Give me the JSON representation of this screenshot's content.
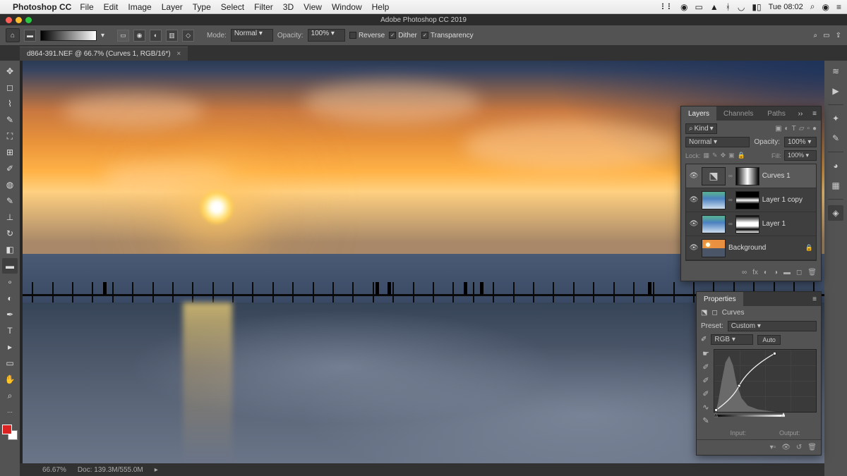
{
  "menubar": {
    "app": "Photoshop CC",
    "items": [
      "File",
      "Edit",
      "Image",
      "Layer",
      "Type",
      "Select",
      "Filter",
      "3D",
      "View",
      "Window",
      "Help"
    ],
    "clock": "Tue 08:02"
  },
  "app_titlebar": {
    "title": "Adobe Photoshop CC 2019"
  },
  "options": {
    "mode_label": "Mode:",
    "mode_value": "Normal",
    "opacity_label": "Opacity:",
    "opacity_value": "100%",
    "reverse": "Reverse",
    "dither": "Dither",
    "transparency": "Transparency"
  },
  "doc_tab": {
    "title": "d864-391.NEF @ 66.7% (Curves 1, RGB/16*)"
  },
  "status": {
    "zoom": "66.67%",
    "doc": "Doc: 139.3M/555.0M"
  },
  "layers_panel": {
    "tabs": [
      "Layers",
      "Channels",
      "Paths"
    ],
    "filter_label": "Kind",
    "blend_mode": "Normal",
    "opacity_label": "Opacity:",
    "opacity_value": "100%",
    "lock_label": "Lock:",
    "fill_label": "Fill:",
    "fill_value": "100%",
    "layers": [
      {
        "name": "Curves 1"
      },
      {
        "name": "Layer 1 copy"
      },
      {
        "name": "Layer 1"
      },
      {
        "name": "Background"
      }
    ]
  },
  "properties_panel": {
    "tab": "Properties",
    "adj_name": "Curves",
    "preset_label": "Preset:",
    "preset_value": "Custom",
    "channel_value": "RGB",
    "auto": "Auto",
    "input_label": "Input:",
    "output_label": "Output:"
  }
}
